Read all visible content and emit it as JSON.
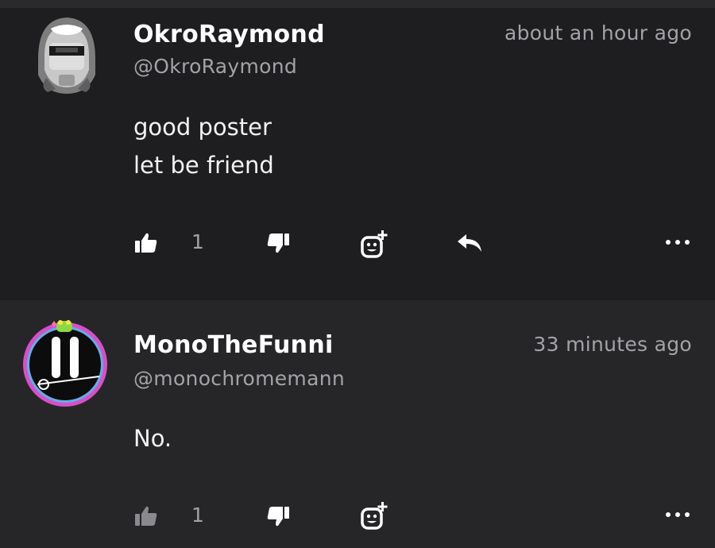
{
  "colors": {
    "background": "#1c1c1e",
    "comment_alt_background": "#262628",
    "text_primary": "#ffffff",
    "text_secondary": "#a3a3a7",
    "icon_active": "#ffffff",
    "icon_muted": "#8a8a8e",
    "avatar_ring": "#d84fc8"
  },
  "comments": [
    {
      "username": "OkroRaymond",
      "handle": "@OkroRaymond",
      "time": "about an hour ago",
      "body_lines": [
        "good poster",
        "let be friend"
      ],
      "likes": "1",
      "icons": [
        "thumbs-up-icon",
        "thumbs-down-icon",
        "add-reaction-icon",
        "reply-icon",
        "more-icon"
      ]
    },
    {
      "username": "MonoTheFunni",
      "handle": "@monochromemann",
      "time": "33 minutes ago",
      "body_lines": [
        "No."
      ],
      "likes": "1",
      "icons": [
        "thumbs-up-icon",
        "thumbs-down-icon",
        "add-reaction-icon",
        "more-icon"
      ]
    }
  ]
}
